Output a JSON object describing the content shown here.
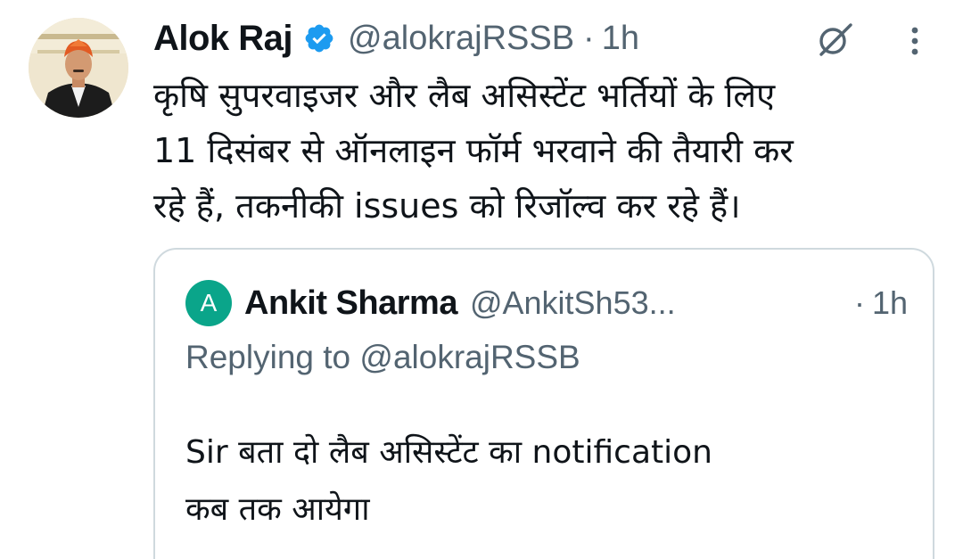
{
  "tweet": {
    "author_name": "Alok Raj",
    "handle": "@alokrajRSSB",
    "separator": "·",
    "time": "1h",
    "body_lines": [
      "कृषि सुपरवाइजर और लैब असिस्टेंट भर्तियों के लिए",
      "11 दिसंबर से ऑनलाइन फॉर्म भरवाने की तैयारी कर",
      "रहे हैं, तकनीकी issues को रिजॉल्व कर रहे हैं।"
    ],
    "icons": {
      "verified": "verified-badge-icon",
      "grok": "grok-icon",
      "more": "more-vertical-icon"
    }
  },
  "quoted_tweet": {
    "avatar_letter": "A",
    "author_name": "Ankit Sharma",
    "handle": "@AnkitSh53...",
    "separator": "·",
    "time": "1h",
    "replying_to": "Replying to @alokrajRSSB",
    "body_lines": [
      "Sir बता दो लैब असिस्टेंट का notification",
      "कब तक आयेगा"
    ]
  },
  "colors": {
    "text_primary": "#0f1419",
    "text_secondary": "#536471",
    "verified_blue": "#1d9bf0",
    "border": "#cfd9de",
    "quote_avatar": "#0aa58a"
  }
}
